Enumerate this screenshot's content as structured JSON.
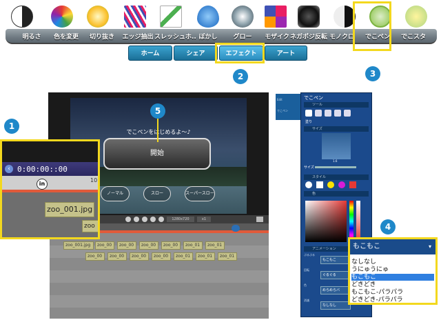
{
  "toolbar": {
    "items": [
      {
        "label": "明るさ",
        "icon": "brightness-icon"
      },
      {
        "label": "色を変更",
        "icon": "color-wheel-icon"
      },
      {
        "label": "切り抜き",
        "icon": "crop-lightbulb-icon"
      },
      {
        "label": "エッジ抽出",
        "icon": "edge-icon"
      },
      {
        "label": "スレッシュホ..",
        "icon": "threshold-icon"
      },
      {
        "label": "ぼかし",
        "icon": "blur-drop-icon"
      },
      {
        "label": "グロー",
        "icon": "glow-icon"
      },
      {
        "label": "モザイク",
        "icon": "mosaic-icon"
      },
      {
        "label": "ネガポジ反転",
        "icon": "camera-icon"
      },
      {
        "label": "モノクロ",
        "icon": "yin-yang-icon"
      },
      {
        "label": "でこペン",
        "icon": "decopen-icon"
      },
      {
        "label": "でこスタ",
        "icon": "decosta-icon"
      }
    ]
  },
  "tabs": [
    {
      "label": "ホーム"
    },
    {
      "label": "シェア"
    },
    {
      "label": "エフェクト"
    },
    {
      "label": "アート"
    }
  ],
  "callouts": {
    "n1": "1",
    "n2": "2",
    "n3": "3",
    "n4": "4",
    "n5": "5"
  },
  "video": {
    "message": "でこペンをはじめるよ～♪",
    "start_button": "開始",
    "modes": [
      "ノーマル",
      "スロー",
      "スーパースロー"
    ],
    "resolution": "1280x720",
    "zoom": "x1"
  },
  "zoom_inset": {
    "timecode": "0:00:00::00",
    "in_marker": "in",
    "clip_name": "zoo_001.jpg",
    "short_clip": "zoo",
    "ruler_mark": "10"
  },
  "timeline": {
    "clips_row1": [
      "zoo_001.jpg",
      "zoo_00",
      "zoo_00",
      "zoo_00",
      "zoo_00",
      "zoo_01",
      "zoo_01"
    ],
    "clips_row2": [
      "zoo_00",
      "zoo_00",
      "zoo_00",
      "zoo_00",
      "zoo_01",
      "zoo_01",
      "zoo_01"
    ]
  },
  "panel": {
    "title": "でこペン",
    "sections": {
      "tool": "ツール",
      "size": "サイズ",
      "style": "スタイル",
      "color": "色",
      "animation": "アニメーション"
    },
    "checkbox_label": "塗り",
    "size_label": "サイズ",
    "size_value": "1.6",
    "anim_rows": [
      {
        "label": "ぷるぷる",
        "value": "もこもこ"
      },
      {
        "label": "回転",
        "value": "ぐるぐる"
      },
      {
        "label": "色",
        "value": "めらめらバ"
      },
      {
        "label": "消滅",
        "value": "なしなし"
      }
    ]
  },
  "subpanel": {
    "item1": "Edit",
    "item2": "でこペン"
  },
  "dropdown": {
    "selected": "もこもこ",
    "options": [
      "なしなし",
      "うにゅうにゅ",
      "もこもこ",
      "どきどき",
      "もこもこ-パラパラ",
      "どきどき-パラパラ"
    ],
    "highlighted_index": 2
  },
  "colors": {
    "accent": "#f3d81e",
    "callout": "#1f88c9",
    "panel": "#1b4a8c",
    "tab": "#1b6f97"
  }
}
